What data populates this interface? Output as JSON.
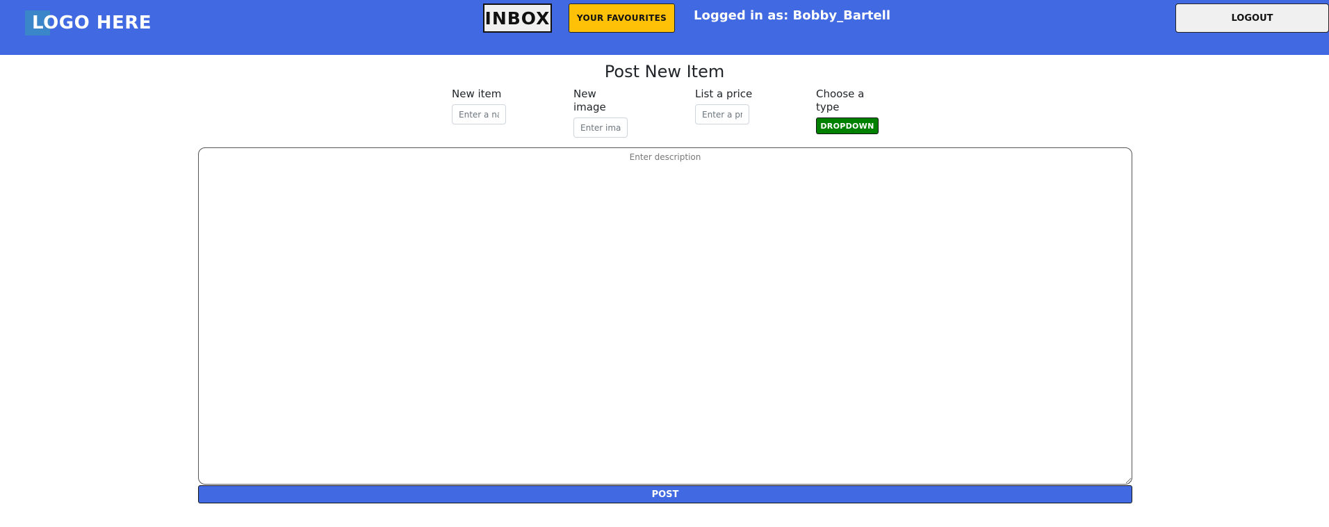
{
  "navbar": {
    "logo_text": "LOGO HERE",
    "inbox_label": "INBOX",
    "favourites_label": "YOUR FAVOURITES",
    "logged_in_text": "Logged in as: Bobby_Bartell",
    "logout_label": "LOGOUT",
    "background_color": "#4169e1"
  },
  "form": {
    "title": "Post New Item",
    "new_item": {
      "label": "New item",
      "placeholder": "Enter a name",
      "value": ""
    },
    "new_image": {
      "label": "New image",
      "placeholder": "Enter image",
      "value": ""
    },
    "price": {
      "label": "List a price",
      "placeholder": "Enter a price",
      "value": ""
    },
    "type": {
      "label": "Choose a type",
      "dropdown_label": "DROPDOWN"
    },
    "description": {
      "placeholder": "Enter description",
      "value": ""
    },
    "post_label": "POST"
  },
  "colors": {
    "favourites_button": "#ffc107",
    "dropdown_button": "#008000",
    "post_button": "#4169e1"
  }
}
